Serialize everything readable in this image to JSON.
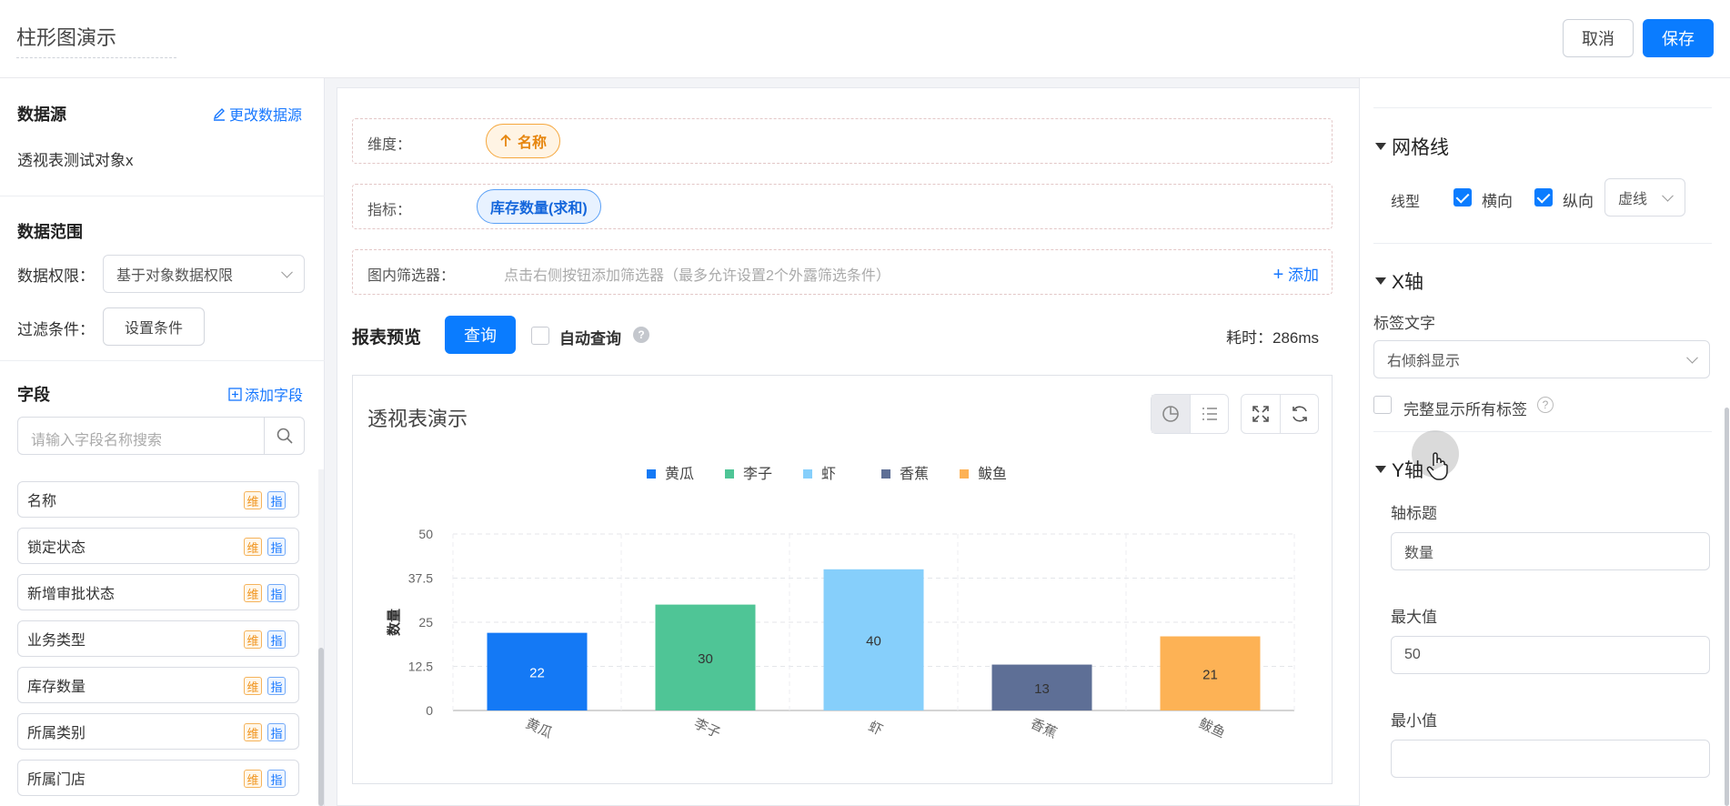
{
  "header": {
    "title": "柱形图演示",
    "cancel_label": "取消",
    "save_label": "保存"
  },
  "left": {
    "datasource_title": "数据源",
    "change_datasource": "更改数据源",
    "datasource_name": "透视表测试对象x",
    "range_title": "数据范围",
    "permission_label": "数据权限：",
    "permission_value": "基于对象数据权限",
    "filter_label": "过滤条件：",
    "filter_button": "设置条件",
    "fields_title": "字段",
    "add_field": "添加字段",
    "search_placeholder": "请输入字段名称搜索",
    "dim_tag": "维",
    "metric_tag": "指",
    "fields": [
      "名称",
      "锁定状态",
      "新增审批状态",
      "业务类型",
      "库存数量",
      "所属类别",
      "所属门店"
    ]
  },
  "center": {
    "dimension_label": "维度：",
    "dimension_pill": "名称",
    "metric_label": "指标：",
    "metric_pill": "库存数量(求和)",
    "filter_label": "图内筛选器：",
    "filter_placeholder": "点击右侧按钮添加筛选器（最多允许设置2个外露筛选条件）",
    "add_label": "添加",
    "preview_title": "报表预览",
    "query_label": "查询",
    "auto_query_label": "自动查询",
    "elapsed": "耗时：286ms",
    "chart_title": "透视表演示"
  },
  "chart_data": {
    "type": "bar",
    "categories": [
      "黄瓜",
      "李子",
      "虾",
      "香蕉",
      "鲅鱼"
    ],
    "values": [
      22,
      30,
      40,
      13,
      21
    ],
    "colors": [
      "#1479f5",
      "#4fc596",
      "#86cffb",
      "#5e6f96",
      "#fdb255"
    ],
    "legend": [
      "黄瓜",
      "李子",
      "虾",
      "香蕉",
      "鲅鱼"
    ],
    "ylabel": "数量",
    "ylim": [
      0,
      50
    ],
    "yticks": [
      "0",
      "12.5",
      "25",
      "37.5",
      "50"
    ],
    "grid": true,
    "legend_position": "top"
  },
  "right": {
    "gridline_title": "网格线",
    "line_type_label": "线型",
    "horizontal_label": "横向",
    "vertical_label": "纵向",
    "line_style": "虚线",
    "xaxis_title": "X轴",
    "label_text_label": "标签文字",
    "label_text_value": "右倾斜显示",
    "show_all_labels": "完整显示所有标签",
    "yaxis_title": "Y轴",
    "axis_title_label": "轴标题",
    "axis_title_value": "数量",
    "max_label": "最大值",
    "max_value": "50",
    "min_label": "最小值",
    "min_value": ""
  }
}
